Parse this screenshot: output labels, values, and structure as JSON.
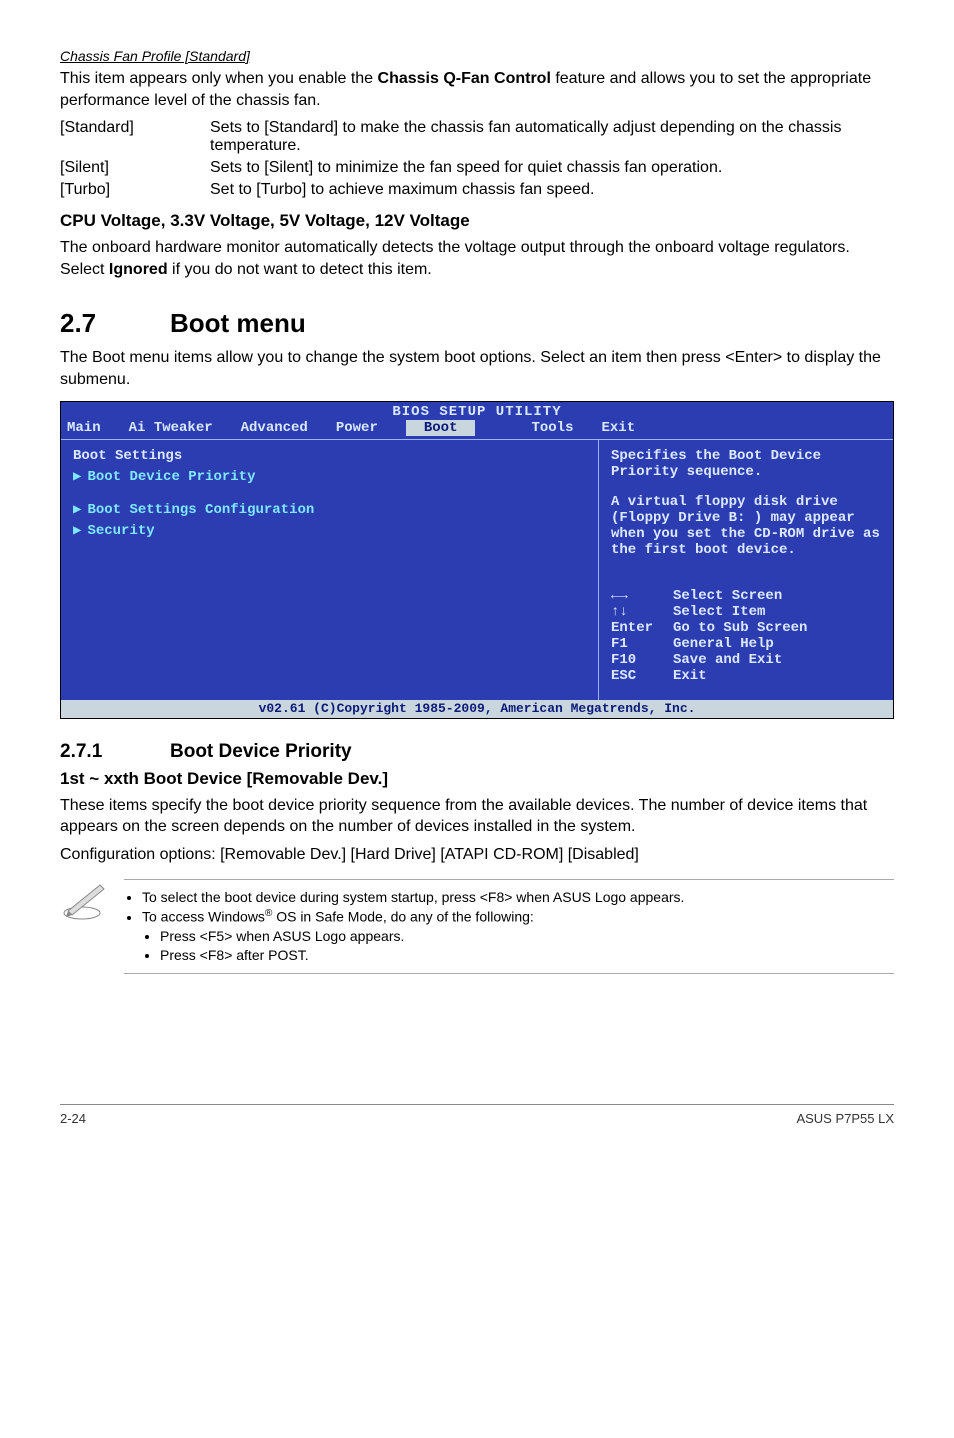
{
  "fanProfile": {
    "heading": "Chassis Fan Profile [Standard]",
    "intro_l1": "This item appears only when you enable the ",
    "intro_bold": "Chassis Q-Fan Control",
    "intro_l2": " feature and allows you to set the appropriate performance level of the chassis fan.",
    "rows": [
      {
        "key": "[Standard]",
        "val": "Sets to [Standard] to make the chassis fan automatically adjust depending on the chassis temperature."
      },
      {
        "key": "[Silent]",
        "val": "Sets to [Silent] to minimize the fan speed for quiet chassis fan operation."
      },
      {
        "key": "[Turbo]",
        "val": "Set to [Turbo] to achieve maximum chassis fan speed."
      }
    ]
  },
  "cpuVolt": {
    "heading": "CPU Voltage, 3.3V Voltage, 5V Voltage, 12V Voltage",
    "body_a": "The onboard hardware monitor automatically detects the voltage output through the onboard voltage regulators. Select ",
    "body_bold": "Ignored",
    "body_b": " if you do not want to detect this item."
  },
  "bootMenu": {
    "num": "2.7",
    "title": "Boot menu",
    "intro": "The Boot menu items allow you to change the system boot options. Select an item then press <Enter> to display the submenu."
  },
  "bios": {
    "title": "BIOS SETUP UTILITY",
    "menu": {
      "main": "Main",
      "ai": "Ai Tweaker",
      "adv": "Advanced",
      "power": "Power",
      "boot": "Boot",
      "tools": "Tools",
      "exit": "Exit"
    },
    "left": {
      "header": "Boot Settings",
      "items": [
        "Boot Device Priority",
        "Boot Settings Configuration",
        "Security"
      ]
    },
    "right": {
      "top": "Specifies the Boot Device Priority sequence.",
      "mid": "A virtual floppy disk drive (Floppy Drive B: ) may appear when you set the CD-ROM drive as the first boot device.",
      "keys": [
        {
          "k": "←→",
          "v": "Select Screen"
        },
        {
          "k": "↑↓",
          "v": "Select Item"
        },
        {
          "k": "Enter",
          "v": "Go to Sub Screen"
        },
        {
          "k": "F1",
          "v": "General Help"
        },
        {
          "k": "F10",
          "v": "Save and Exit"
        },
        {
          "k": "ESC",
          "v": "Exit"
        }
      ]
    },
    "foot": "v02.61 (C)Copyright 1985-2009, American Megatrends, Inc."
  },
  "bootPriority": {
    "num": "2.7.1",
    "title": "Boot Device Priority",
    "sub": "1st ~ xxth Boot Device [Removable Dev.]",
    "body": "These items specify the boot device priority sequence from the available devices. The number of device items that appears on the screen depends on the number of devices installed in the system.",
    "conf": "Configuration options: [Removable Dev.] [Hard Drive] [ATAPI CD-ROM] [Disabled]"
  },
  "note": {
    "b1": "To select the boot device during system startup, press <F8> when ASUS Logo appears.",
    "b2a": "To access Windows",
    "b2b": " OS in Safe Mode, do any of the following:",
    "s1": "Press <F5> when ASUS Logo appears.",
    "s2": "Press <F8> after POST."
  },
  "footer": {
    "left": "2-24",
    "right": "ASUS P7P55 LX"
  }
}
